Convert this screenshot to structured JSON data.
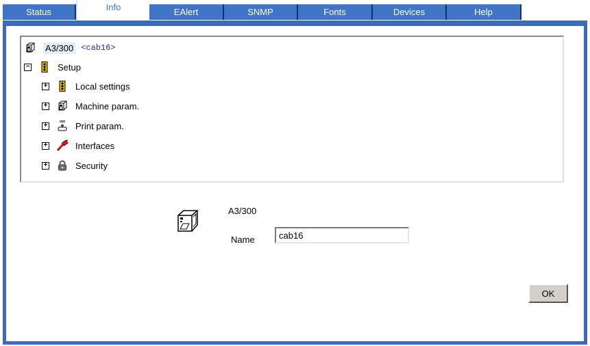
{
  "tabs": [
    {
      "label": "Status"
    },
    {
      "label": "Info",
      "active": true
    },
    {
      "label": "EAlert"
    },
    {
      "label": "SNMP"
    },
    {
      "label": "Fonts"
    },
    {
      "label": "Devices"
    },
    {
      "label": "Help"
    }
  ],
  "tree": {
    "root": {
      "label": "A3/300",
      "name": "<cab16>",
      "icon": "printer-icon"
    },
    "setup": {
      "label": "Setup",
      "toggle": "−",
      "icon": "traffic-light-icon"
    },
    "children": [
      {
        "label": "Local settings",
        "toggle": "+",
        "icon": "traffic-light-icon"
      },
      {
        "label": "Machine param.",
        "toggle": "+",
        "icon": "printer-icon"
      },
      {
        "label": "Print param.",
        "toggle": "+",
        "icon": "print-head-icon"
      },
      {
        "label": "Interfaces",
        "toggle": "+",
        "icon": "cable-icon"
      },
      {
        "label": "Security",
        "toggle": "+",
        "icon": "padlock-icon"
      }
    ]
  },
  "detail": {
    "model": "A3/300",
    "name_label": "Name",
    "name_value": "cab16"
  },
  "buttons": {
    "ok": "OK"
  },
  "colors": {
    "frame": "#3a6bbf",
    "tab": "#3f74c6",
    "link": "#2a2aa5"
  }
}
